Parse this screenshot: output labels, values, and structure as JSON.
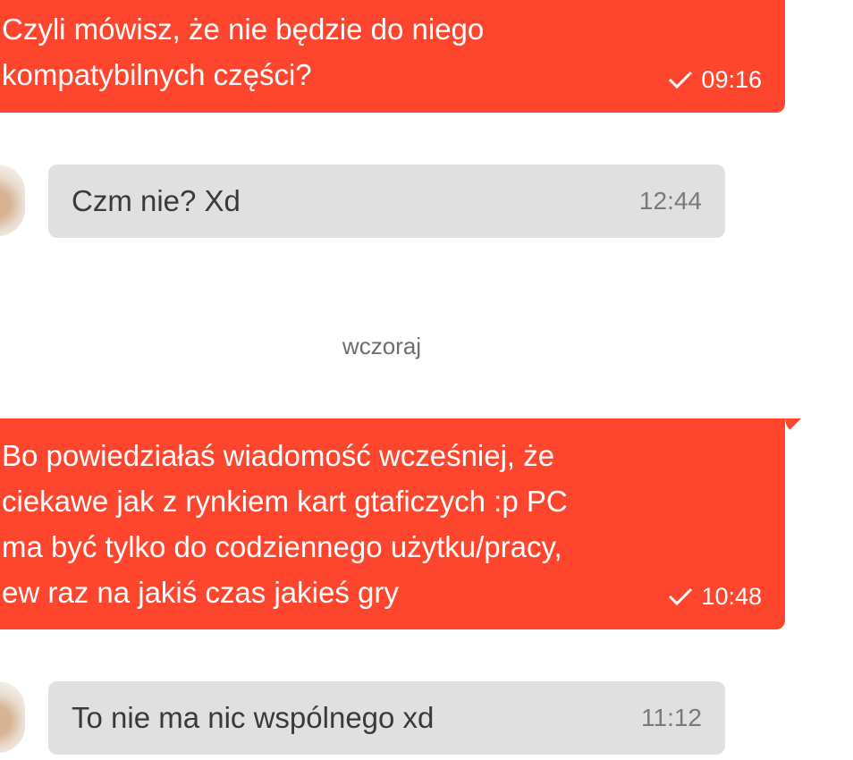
{
  "messages": [
    {
      "direction": "outgoing",
      "text": "Czyli mówisz, że nie będzie do niego\nkompatybilnych części?",
      "time": "09:16",
      "status_icon": "check-icon"
    },
    {
      "direction": "incoming",
      "text": "Czm nie? Xd",
      "time": "12:44",
      "avatar_icon": "avatar"
    },
    {
      "direction": "outgoing",
      "text": "Bo powiedziałaś wiadomość wcześniej, że\nciekawe jak z rynkiem kart gtaficzych :p PC\nma być tylko do codziennego użytku/pracy,\new raz na jakiś czas jakieś gry",
      "time": "10:48",
      "status_icon": "check-icon"
    },
    {
      "direction": "incoming",
      "text": "To nie ma nic wspólnego xd",
      "time": "11:12",
      "avatar_icon": "avatar"
    }
  ],
  "date_separator": "wczoraj",
  "colors": {
    "outgoing_bubble": "#fe452e",
    "incoming_bubble": "#e0e0e0",
    "background": "#ffffff"
  }
}
